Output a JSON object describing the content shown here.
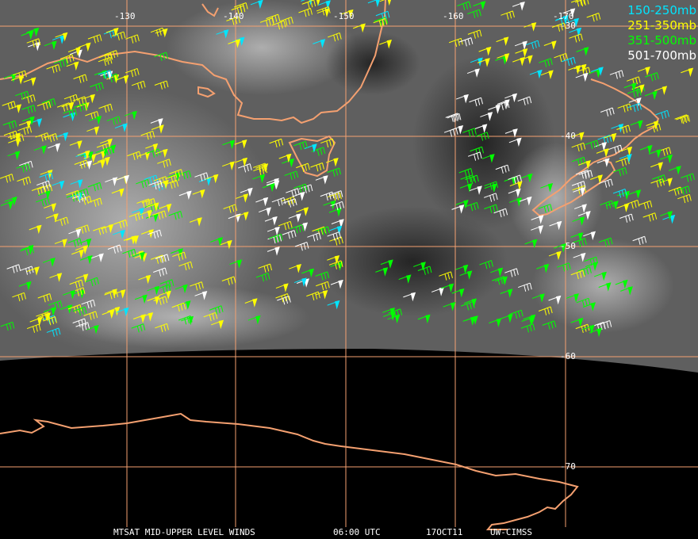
{
  "legend": [
    {
      "label": "150-250mb",
      "color": "#00e5ff"
    },
    {
      "label": "251-350mb",
      "color": "#ffff00"
    },
    {
      "label": "351-500mb",
      "color": "#00ff00"
    },
    {
      "label": "501-700mb",
      "color": "#ffffff"
    }
  ],
  "grid": {
    "color": "#f4a070",
    "longitudes": [
      "-130",
      "-140",
      "-150",
      "-160",
      "-170"
    ],
    "latitudes": [
      "-30",
      "-40",
      "-50",
      "-60",
      "-70"
    ]
  },
  "coastline_color": "#f4a070",
  "footer": {
    "product": "MTSAT MID-UPPER LEVEL WINDS",
    "time": "06:00 UTC",
    "date": "17OCT11",
    "source": "UW-CIMSS"
  },
  "wind_layers": [
    "150-250mb",
    "251-350mb",
    "351-500mb",
    "501-700mb"
  ]
}
